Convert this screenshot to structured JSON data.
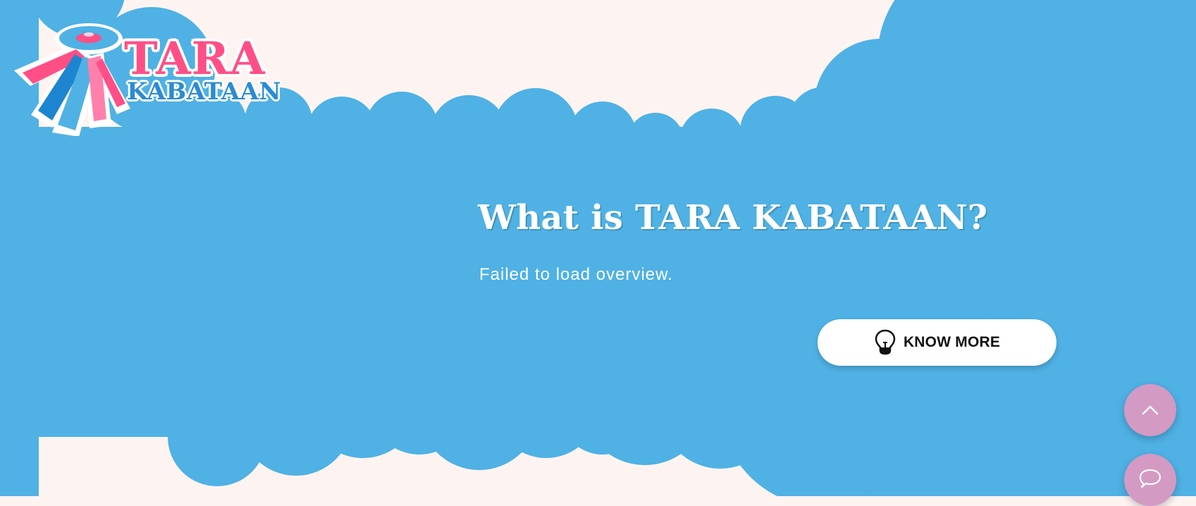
{
  "logo": {
    "line1": "TARA",
    "line2": "KABATAAN"
  },
  "hero": {
    "title": "What is TARA KABATAAN?",
    "description": "Failed to load overview."
  },
  "actions": {
    "know_more_label": "KNOW MORE"
  },
  "icons": {
    "know_more": "lightbulb-icon",
    "scroll_top": "chevron-up-icon",
    "chat": "chat-bubble-icon"
  },
  "colors": {
    "background": "#fdf4f2",
    "cloud_blue": "#4fb1e4",
    "brand_pink": "#ff4f86",
    "brand_blue": "#2b8bd3",
    "fab": "#d39ac4",
    "button_bg": "#ffffff",
    "button_text": "#111111"
  }
}
